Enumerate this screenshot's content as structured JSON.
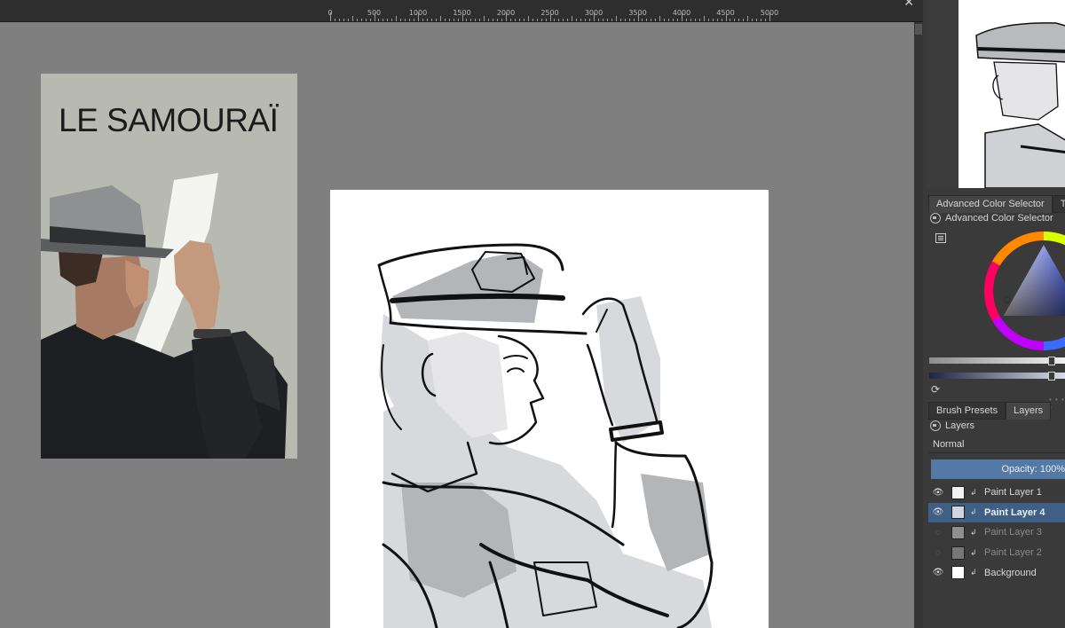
{
  "ruler": {
    "labels": [
      "0",
      "500",
      "1000",
      "1500",
      "2000",
      "2500",
      "3000",
      "3500",
      "4000",
      "4500",
      "5000"
    ]
  },
  "window": {
    "close_glyph": "✕"
  },
  "reference": {
    "title": "LE SAMOURAÏ"
  },
  "dock": {
    "color_tabs": [
      "Advanced Color Selector",
      "T"
    ],
    "color_docker_title": "Advanced Color Selector",
    "layer_tabs": [
      "Brush Presets",
      "Layers"
    ],
    "layers_docker_title": "Layers",
    "blend_mode": "Normal",
    "opacity_label": "Opacity:",
    "opacity_value": "100%",
    "layers": [
      {
        "name": "Paint Layer 1",
        "visible": true,
        "selected": false
      },
      {
        "name": "Paint Layer 4",
        "visible": true,
        "selected": true
      },
      {
        "name": "Paint Layer 3",
        "visible": false,
        "selected": false
      },
      {
        "name": "Paint Layer 2",
        "visible": false,
        "selected": false
      },
      {
        "name": "Background",
        "visible": true,
        "selected": false
      }
    ]
  },
  "icons": {
    "eye": "eye-icon",
    "lock": "lock-icon",
    "refresh": "refresh-icon",
    "list": "list-view-icon",
    "inherit_alpha": "inherit-alpha-icon"
  },
  "colors": {
    "workspace": "#7f7f7f",
    "accent": "#5379a4",
    "selection": "#3f5f84"
  }
}
